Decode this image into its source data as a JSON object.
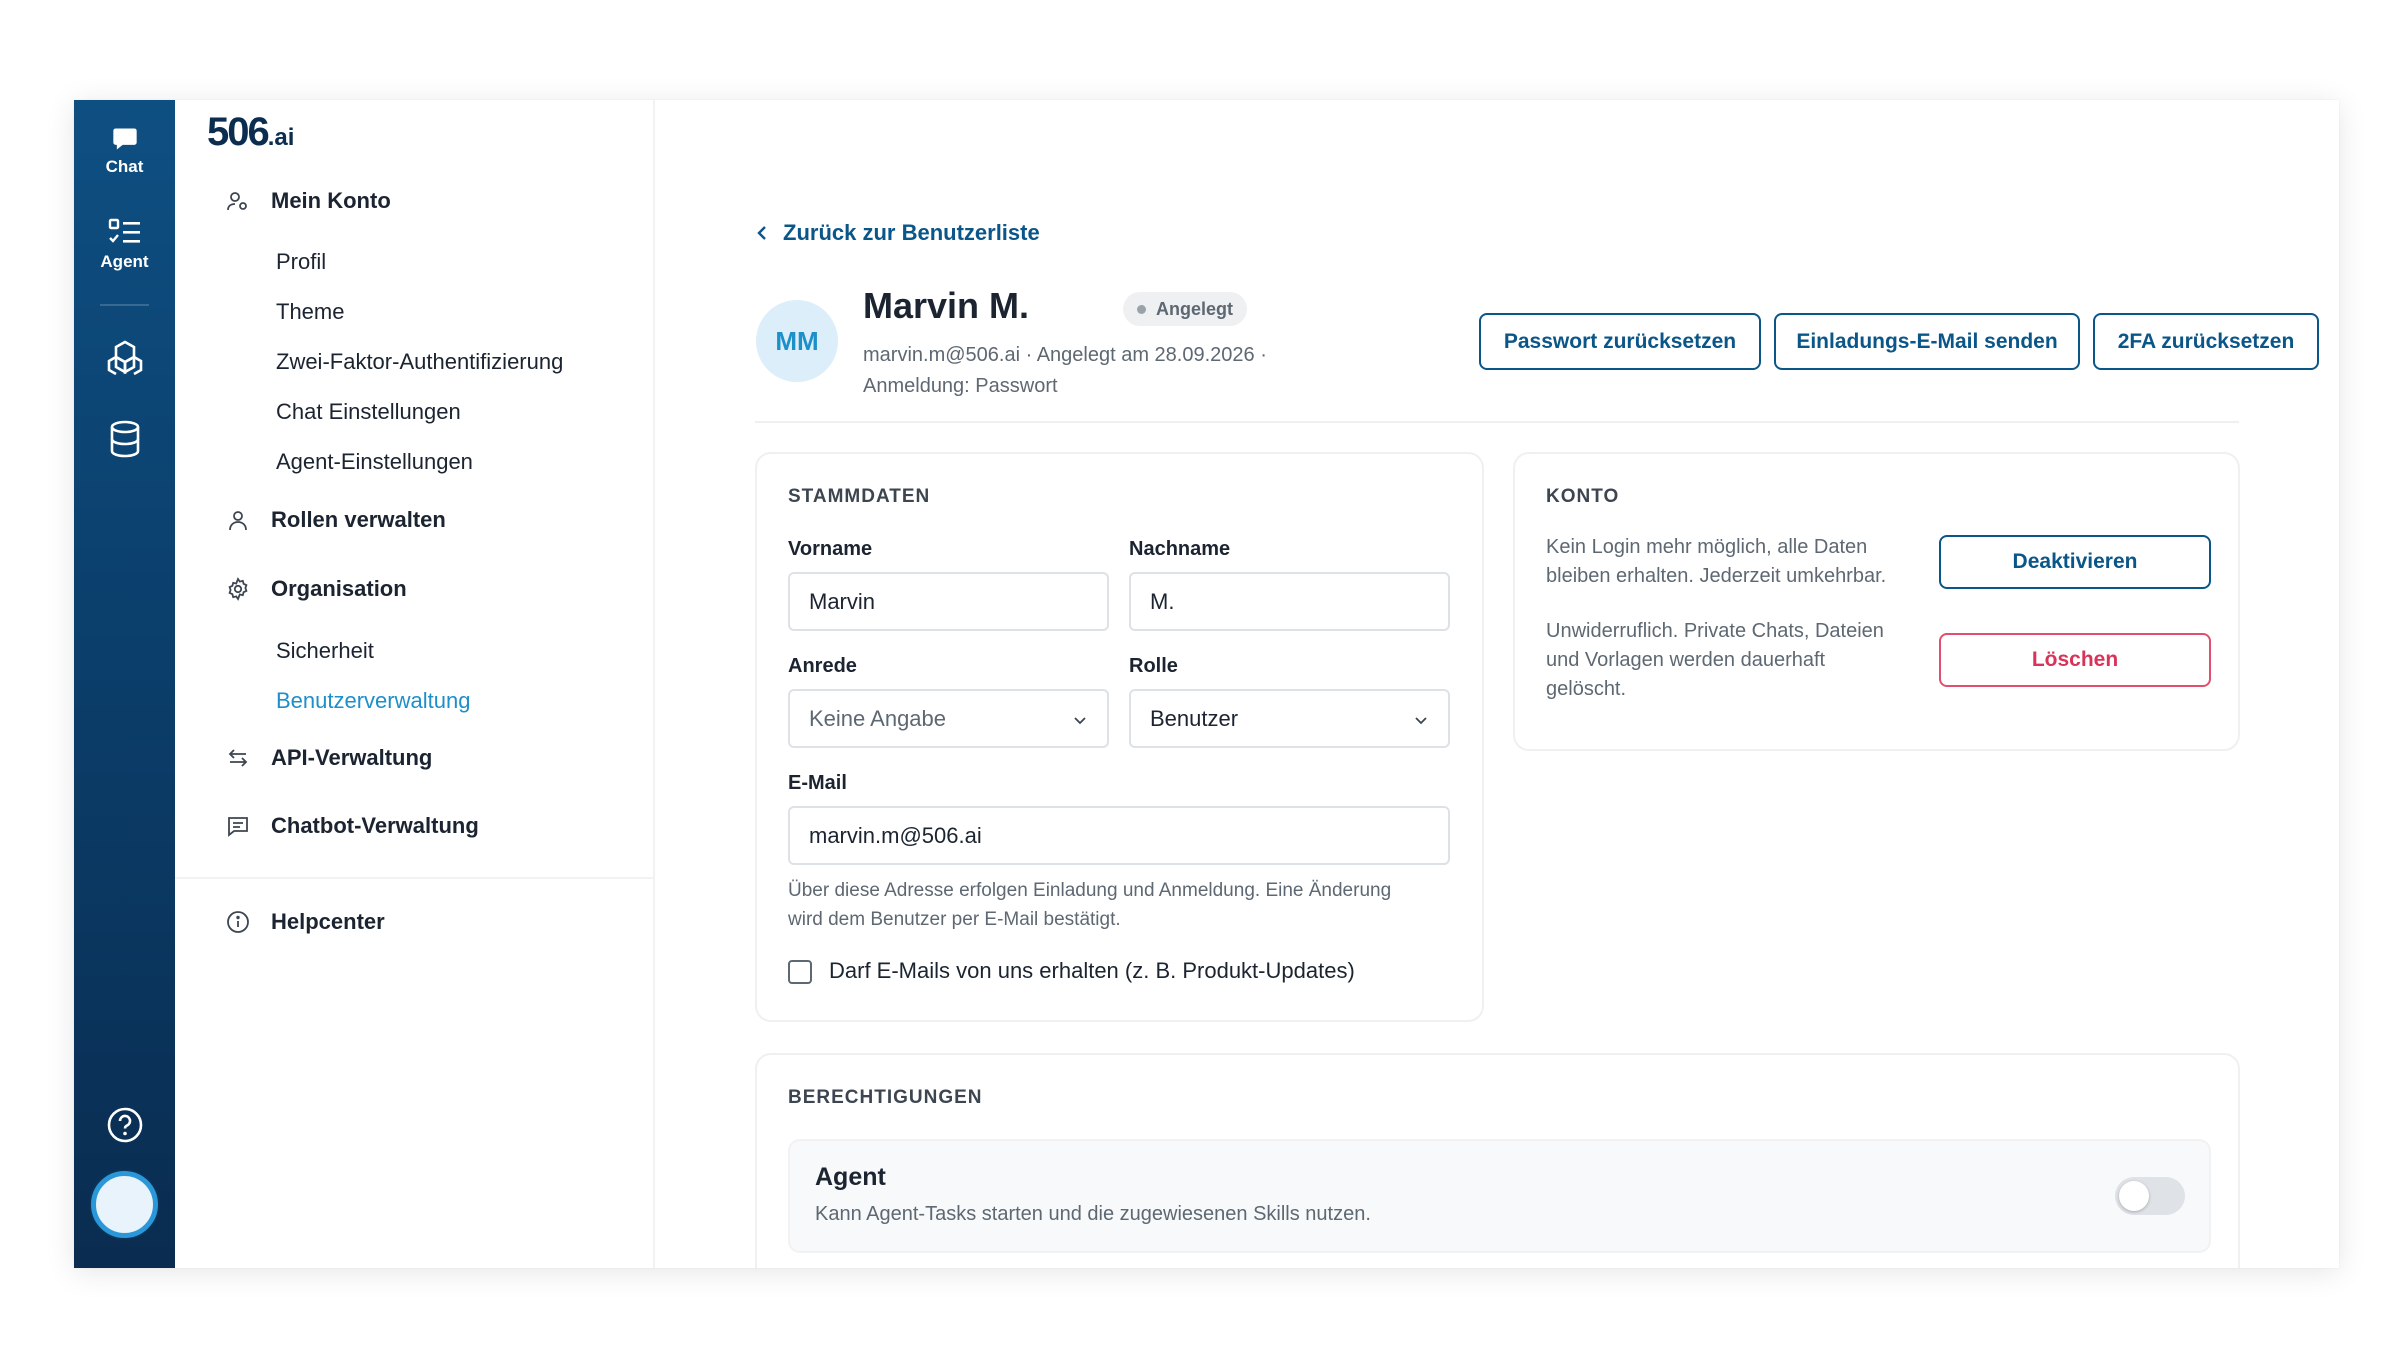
{
  "rail": {
    "chat_label": "Chat",
    "agent_label": "Agent"
  },
  "logo": {
    "main": "506",
    "suffix": ".ai"
  },
  "sidebar": {
    "mein_konto": "Mein Konto",
    "mein_konto_items": [
      "Profil",
      "Theme",
      "Zwei-Faktor-Authentifizierung",
      "Chat Einstellungen",
      "Agent-Einstellungen"
    ],
    "rollen": "Rollen verwalten",
    "organisation": "Organisation",
    "organisation_items": [
      "Sicherheit",
      "Benutzerverwaltung"
    ],
    "api": "API-Verwaltung",
    "chatbot": "Chatbot-Verwaltung",
    "helpcenter": "Helpcenter"
  },
  "header": {
    "back_label": "Zurück zur Benutzerliste",
    "initials": "MM",
    "name": "Marvin M.",
    "status": "Angelegt",
    "meta_line1": "marvin.m@506.ai · Angelegt am 28.09.2026 ·",
    "meta_line2": "Anmeldung: Passwort",
    "btn_reset_password": "Passwort zurücksetzen",
    "btn_invite": "Einladungs-E-Mail senden",
    "btn_reset_2fa": "2FA zurücksetzen"
  },
  "stammdaten": {
    "title": "STAMMDATEN",
    "vorname_label": "Vorname",
    "vorname_value": "Marvin",
    "nachname_label": "Nachname",
    "nachname_value": "M.",
    "anrede_label": "Anrede",
    "anrede_value": "Keine Angabe",
    "rolle_label": "Rolle",
    "rolle_value": "Benutzer",
    "email_label": "E-Mail",
    "email_value": "marvin.m@506.ai",
    "email_hint_line1": "Über diese Adresse erfolgen Einladung und Anmeldung. Eine Änderung",
    "email_hint_line2": "wird dem Benutzer per E-Mail bestätigt.",
    "newsletter_label": "Darf E-Mails von uns erhalten (z. B. Produkt-Updates)",
    "newsletter_checked": false
  },
  "konto": {
    "title": "KONTO",
    "deactivate_text_line1": "Kein Login mehr möglich, alle Daten",
    "deactivate_text_line2": "bleiben erhalten. Jederzeit umkehrbar.",
    "deactivate_button": "Deaktivieren",
    "delete_text_line1": "Unwiderruflich. Private Chats, Dateien",
    "delete_text_line2": "und Vorlagen werden dauerhaft",
    "delete_text_line3": "gelöscht.",
    "delete_button": "Löschen"
  },
  "berechtigungen": {
    "title": "BERECHTIGUNGEN",
    "items": [
      {
        "title": "Agent",
        "description": "Kann Agent-Tasks starten und die zugewiesenen Skills nutzen.",
        "enabled": false
      }
    ]
  },
  "colors": {
    "rail_top": "#0e4f82",
    "rail_bottom": "#0a2c50",
    "accent": "#0b5688",
    "active_link": "#1d8fc9",
    "danger": "#d8345a"
  }
}
